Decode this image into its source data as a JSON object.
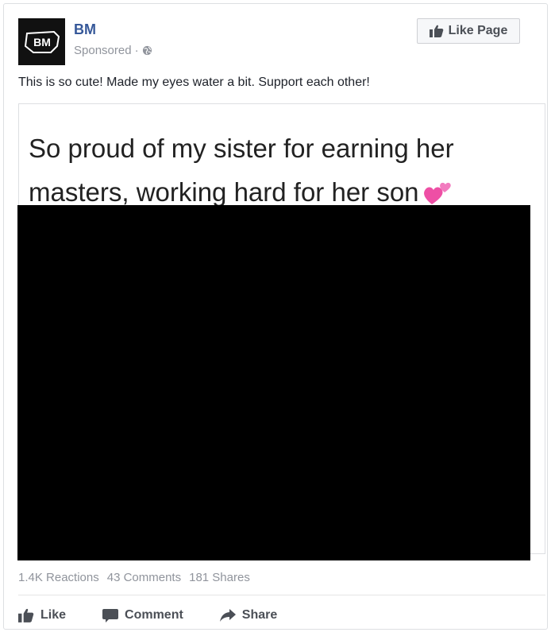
{
  "post": {
    "page_name": "BM",
    "avatar_text": "BM",
    "sponsored_label": "Sponsored",
    "sponsored_separator": "·",
    "caption": "This is so cute! Made my eyes water a bit. Support each other!",
    "like_page_label": "Like Page"
  },
  "media": {
    "line1": "So proud of my sister for earning her",
    "line2": "masters, working hard for her son",
    "image_color": "#000000"
  },
  "stats": {
    "reactions": "1.4K Reactions",
    "comments": "43 Comments",
    "shares": "181 Shares"
  },
  "actions": {
    "like": "Like",
    "comment": "Comment",
    "share": "Share"
  },
  "colors": {
    "page_name": "#365899",
    "muted": "#90949c",
    "action_text": "#4b4f56",
    "border": "#dddfe2"
  },
  "icons": {
    "avatar": "bm-logo-icon",
    "privacy": "globe-icon",
    "like_page": "thumbs-up-icon",
    "like": "thumbs-up-icon",
    "comment": "comment-bubble-icon",
    "share": "share-arrow-icon",
    "heart": "two-hearts-icon"
  }
}
